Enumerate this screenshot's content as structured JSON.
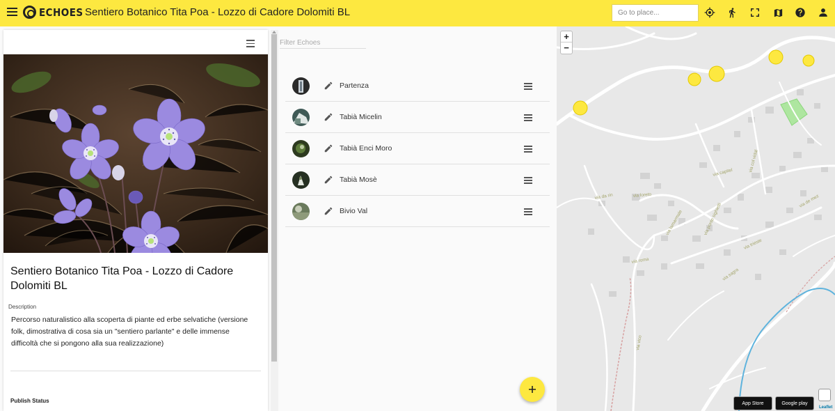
{
  "header": {
    "logo_text": "ECHOES",
    "title": "Sentiero Botanico Tita Poa - Lozzo di Cadore Dolomiti BL",
    "goto_placeholder": "Go to place...",
    "icons": [
      "menu-icon",
      "locate-icon",
      "walk-icon",
      "fullscreen-icon",
      "map-icon",
      "help-icon",
      "account-icon"
    ]
  },
  "track": {
    "title": "Sentiero Botanico Tita Poa - Lozzo di Cadore Dolomiti BL",
    "description_label": "Description",
    "description": "Percorso naturalistico alla scoperta di piante ed erbe selvatiche (versione folk, dimostrativa di cosa sia un \"sentiero parlante\" e delle immense difficoltà che si pongono alla sua realizzazione)",
    "publish_status_label": "Publish Status"
  },
  "echoes": {
    "filter_placeholder": "Filter Echoes",
    "items": [
      {
        "name": "Partenza"
      },
      {
        "name": "Tabià Micelin"
      },
      {
        "name": "Tabià Enci Moro"
      },
      {
        "name": "Tabià Mosè"
      },
      {
        "name": "Bivio Val"
      }
    ]
  },
  "map": {
    "zoom_in": "+",
    "zoom_out": "−",
    "app_store": "App Store",
    "google_play": "Google play",
    "attribution": "Leaflet",
    "marker_color": "#fde840",
    "street_labels": [
      "via da rin",
      "via loreto",
      "via capitel",
      "via col vidal",
      "via lamarmale",
      "via roma",
      "via ponte sighietti",
      "via sagra",
      "via trieste",
      "via de mez",
      "via vico"
    ]
  },
  "colors": {
    "accent": "#fde840",
    "map_bg": "#e8e8e8",
    "water": "#5eb3dd",
    "park": "#aee6a0"
  }
}
